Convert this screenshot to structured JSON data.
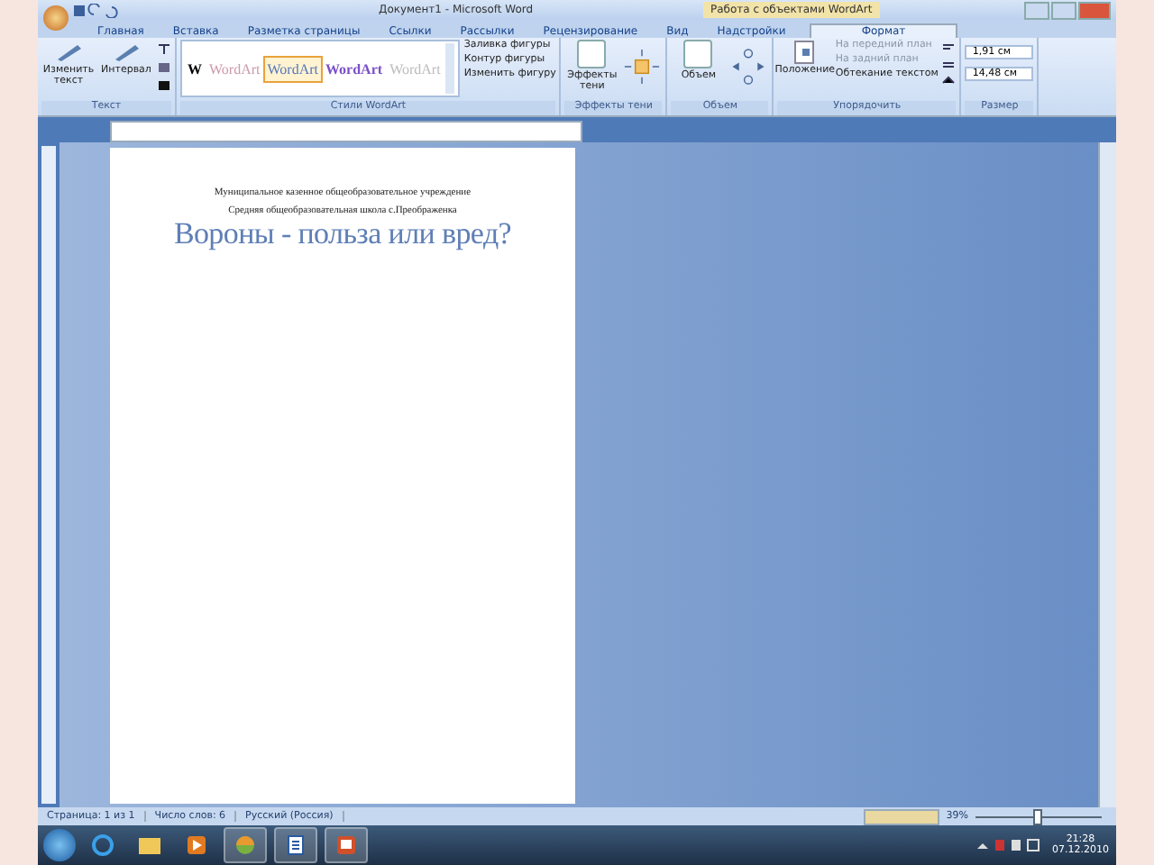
{
  "window": {
    "title": "Документ1 - Microsoft Word",
    "context_title": "Работа с объектами WordArt"
  },
  "tabs": [
    {
      "label": "Главная",
      "selected": false
    },
    {
      "label": "Вставка",
      "selected": false
    },
    {
      "label": "Разметка страницы",
      "selected": false
    },
    {
      "label": "Ссылки",
      "selected": false
    },
    {
      "label": "Рассылки",
      "selected": false
    },
    {
      "label": "Рецензирование",
      "selected": false
    },
    {
      "label": "Вид",
      "selected": false
    },
    {
      "label": "Надстройки",
      "selected": false
    },
    {
      "label": "Формат",
      "selected": true
    }
  ],
  "ribbon_groups": [
    {
      "kind": "text",
      "label": "Текст",
      "buttons": [
        "Изменить текст",
        "Интервал"
      ]
    },
    {
      "kind": "styles",
      "label": "Стили WordArt",
      "styles": [
        {
          "sample": "W",
          "selected": false
        },
        {
          "sample": "WordArt",
          "selected": false
        },
        {
          "sample": "WordArt",
          "selected": true
        },
        {
          "sample": "WordArt",
          "selected": false
        },
        {
          "sample": "WordArt",
          "selected": false
        }
      ],
      "commands": [
        "Заливка фигуры",
        "Контур фигуры",
        "Изменить фигуру"
      ]
    },
    {
      "kind": "shadow",
      "label": "Эффекты тени",
      "buttons": [
        "Эффекты тени"
      ]
    },
    {
      "kind": "volume",
      "label": "Объем",
      "buttons": [
        "Объем"
      ]
    },
    {
      "kind": "arrange",
      "label": "Упорядочить",
      "buttons": [
        "Положение"
      ],
      "commands": [
        "На передний план",
        "На задний план",
        "Обтекание текстом"
      ]
    },
    {
      "kind": "size",
      "label": "Размер",
      "fields": [
        "1,91 см",
        "14,48 см"
      ]
    }
  ],
  "document": {
    "lines": [
      {
        "kind": "small",
        "text": "Муниципальное казенное общеобразовательное учреждение"
      },
      {
        "kind": "small",
        "text": "Средняя общеобразовательная школа с.Преображенка"
      },
      {
        "kind": "wordart",
        "text": "Вороны - польза или вред?"
      }
    ]
  },
  "status_bar": {
    "items": [
      "Страница: 1 из 1",
      "Число слов: 6",
      "Русский (Россия)"
    ],
    "zoom": "39%",
    "zoom_level": {
      "level": 0.45
    }
  },
  "taskbar": {
    "time": "21:28",
    "date": "07.12.2010"
  }
}
